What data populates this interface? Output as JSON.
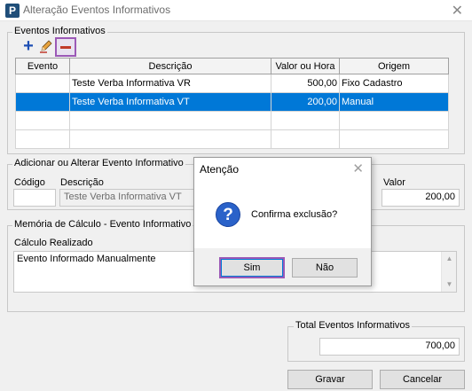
{
  "window": {
    "title": "Alteração Eventos Informativos",
    "icon_letter": "P"
  },
  "eventos": {
    "legend": "Eventos Informativos",
    "columns": [
      "Evento",
      "Descrição",
      "Valor ou Hora",
      "Origem"
    ],
    "rows": [
      {
        "evento": "",
        "descricao": "Teste Verba Informativa VR",
        "valor": "500,00",
        "origem": "Fixo Cadastro"
      },
      {
        "evento": "",
        "descricao": "Teste Verba Informativa VT",
        "valor": "200,00",
        "origem": "Manual"
      }
    ]
  },
  "adicionar": {
    "legend": "Adicionar ou Alterar Evento Informativo",
    "codigo_label": "Código",
    "descricao_label": "Descrição",
    "descricao_value": "Teste Verba Informativa VT",
    "valor_label": "Valor",
    "valor_value": "200,00"
  },
  "memoria": {
    "legend": "Memória de Cálculo - Evento Informativo",
    "calculo_label": "Cálculo Realizado",
    "calculo_text": "Evento Informado Manualmente"
  },
  "total": {
    "legend": "Total Eventos Informativos",
    "value": "700,00"
  },
  "buttons": {
    "gravar": "Gravar",
    "cancelar": "Cancelar"
  },
  "dialog": {
    "title": "Atenção",
    "message": "Confirma exclusão?",
    "sim": "Sim",
    "nao": "Não"
  },
  "colors": {
    "selection": "#0078d7",
    "highlight": "#9b59b6",
    "add_icon": "#1e4fb4",
    "remove_icon": "#c0392b"
  }
}
